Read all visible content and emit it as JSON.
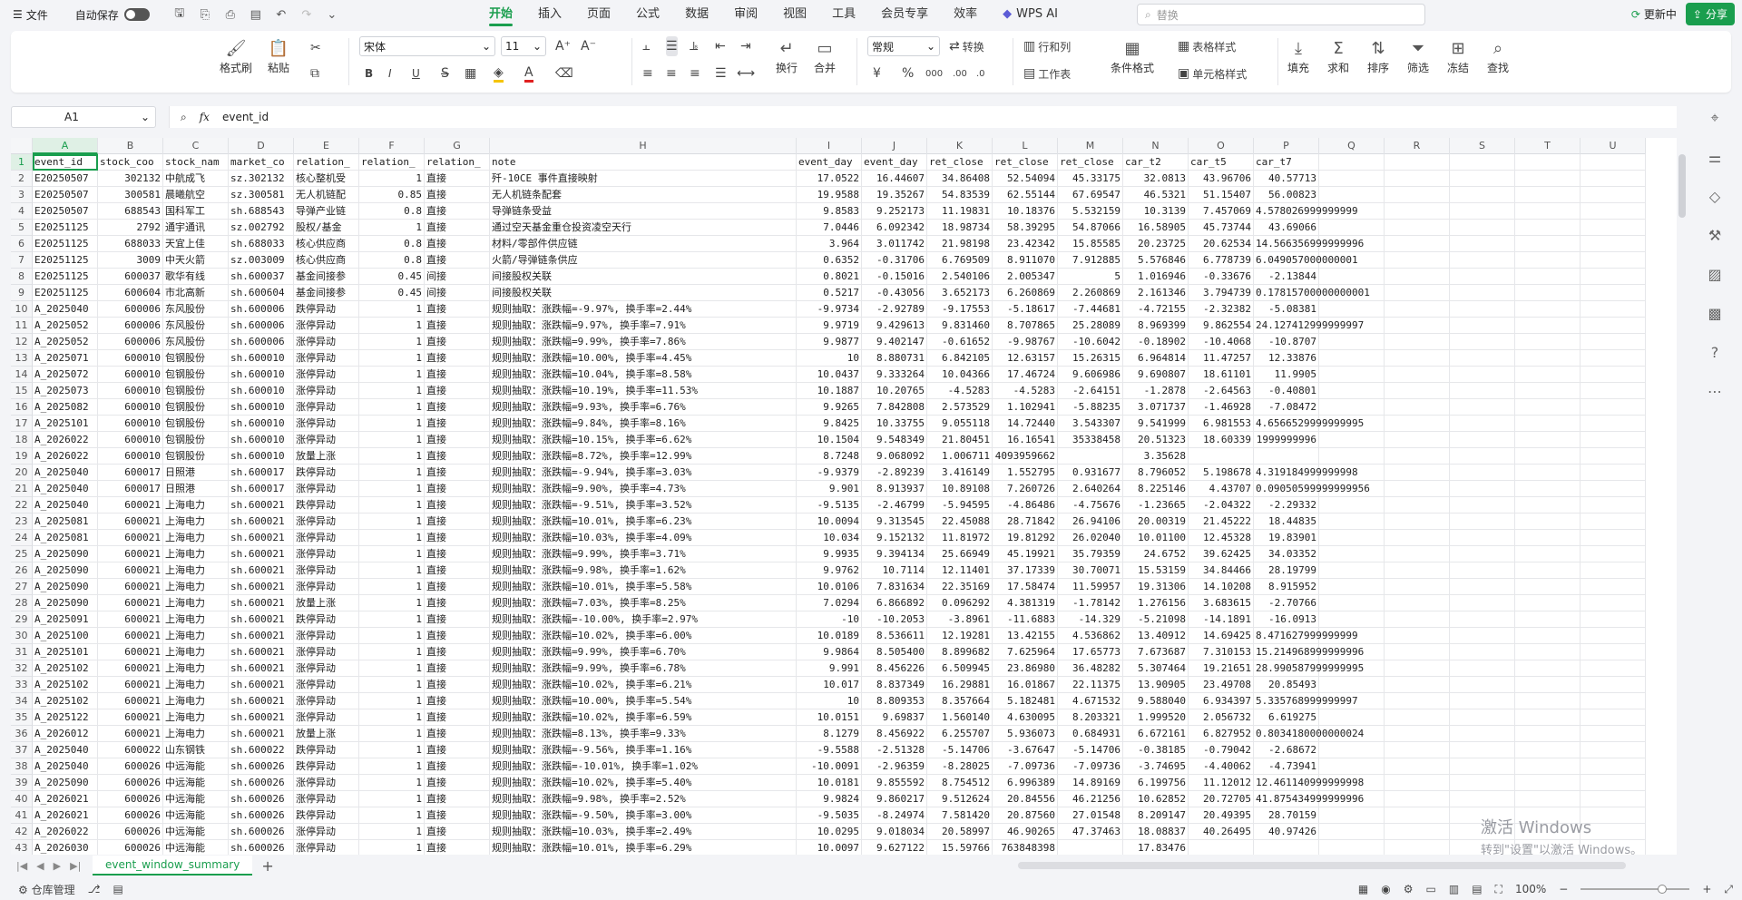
{
  "titlebar": {
    "file_label": "文件",
    "autosave_label": "自动保存",
    "tabs": [
      "开始",
      "插入",
      "页面",
      "公式",
      "数据",
      "审阅",
      "视图",
      "工具",
      "会员专享",
      "效率"
    ],
    "active_tab": "开始",
    "wps_ai_label": "WPS AI",
    "search_placeholder": "替换",
    "update_label": "更新中",
    "share_label": "分享"
  },
  "ribbon": {
    "format_painter": "格式刷",
    "paste": "粘贴",
    "font_name": "宋体",
    "font_size": "11",
    "bold": "B",
    "italic": "I",
    "underline": "U",
    "number_format": "常规",
    "convert": "转换",
    "rows_cols": "行和列",
    "worksheet": "工作表",
    "conditional_format": "条件格式",
    "table_style": "表格样式",
    "cell_style": "单元格样式",
    "fill": "填充",
    "sum": "求和",
    "sort": "排序",
    "filter": "筛选",
    "freeze": "冻结",
    "find": "查找",
    "wrap": "换行",
    "merge": "合并"
  },
  "formula_bar": {
    "cell_ref": "A1",
    "fx": "fx",
    "value": "event_id"
  },
  "grid": {
    "columns": [
      "A",
      "B",
      "C",
      "D",
      "E",
      "F",
      "G",
      "H",
      "I",
      "J",
      "K",
      "L",
      "M",
      "N",
      "O",
      "P",
      "Q",
      "R",
      "S",
      "T",
      "U"
    ],
    "rows": [
      [
        "event_id",
        "stock_coo",
        "stock_nam",
        "market_co",
        "relation_",
        "relation_",
        "relation_",
        "note",
        "event_day",
        "event_day",
        "ret_close",
        "ret_close",
        "ret_close",
        "car_t2",
        "car_t5",
        "car_t7"
      ],
      [
        "E20250507",
        "302132",
        "中航成飞",
        "sz.302132",
        "核心整机受",
        "1",
        "直接",
        "歼-10CE 事件直接映射",
        "17.0522",
        "16.44607",
        "34.86408",
        "52.54094",
        "45.33175",
        "32.0813",
        "43.96706",
        "40.57713"
      ],
      [
        "E20250507",
        "300581",
        "晨曦航空",
        "sz.300581",
        "无人机链配",
        "0.85",
        "直接",
        "无人机链条配套",
        "19.9588",
        "19.35267",
        "54.83539",
        "62.55144",
        "67.69547",
        "46.5321",
        "51.15407",
        "56.00823"
      ],
      [
        "E20250507",
        "688543",
        "国科军工",
        "sh.688543",
        "导弹产业链",
        "0.8",
        "直接",
        "导弹链条受益",
        "9.8583",
        "9.252173",
        "11.19831",
        "10.18376",
        "5.532159",
        "10.3139",
        "7.457069",
        "4.578026999999999"
      ],
      [
        "E20251125",
        "2792",
        "通宇通讯",
        "sz.002792",
        "股权/基金",
        "1",
        "直接",
        "通过空天基金重仓投资凌空天行",
        "7.0446",
        "6.092342",
        "18.98734",
        "58.39295",
        "54.87066",
        "16.58905",
        "45.73744",
        "43.69066"
      ],
      [
        "E20251125",
        "688033",
        "天宜上佳",
        "sh.688033",
        "核心供应商",
        "0.8",
        "直接",
        "材料/零部件供应链",
        "3.964",
        "3.011742",
        "21.98198",
        "23.42342",
        "15.85585",
        "20.23725",
        "20.62534",
        "14.566356999999996"
      ],
      [
        "E20251125",
        "3009",
        "中天火箭",
        "sz.003009",
        "核心供应商",
        "0.8",
        "直接",
        "火箭/导弹链条供应",
        "0.6352",
        "-0.31706",
        "6.769509",
        "8.911070",
        "7.912885",
        "5.576846",
        "6.778739",
        "6.049057000000001"
      ],
      [
        "E20251125",
        "600037",
        "歌华有线",
        "sh.600037",
        "基金间接参",
        "0.45",
        "间接",
        "间接股权关联",
        "0.8021",
        "-0.15016",
        "2.540106",
        "2.005347",
        "5",
        "1.016946",
        "-0.33676",
        "-2.13844"
      ],
      [
        "E20251125",
        "600604",
        "市北高新",
        "sh.600604",
        "基金间接参",
        "0.45",
        "间接",
        "间接股权关联",
        "0.5217",
        "-0.43056",
        "3.652173",
        "6.260869",
        "2.260869",
        "2.161346",
        "3.794739",
        "0.17815700000000001"
      ],
      [
        "A_2025040",
        "600006",
        "东风股份",
        "sh.600006",
        "跌停异动",
        "1",
        "直接",
        "规则抽取：涨跌幅=-9.97%, 换手率=2.44%",
        "-9.9734",
        "-2.92789",
        "-9.17553",
        "-5.18617",
        "-7.44681",
        "-4.72155",
        "-2.32382",
        "-5.08381"
      ],
      [
        "A_2025052",
        "600006",
        "东风股份",
        "sh.600006",
        "涨停异动",
        "1",
        "直接",
        "规则抽取：涨跌幅=9.97%, 换手率=7.91%",
        "9.9719",
        "9.429613",
        "9.831460",
        "8.707865",
        "25.28089",
        "8.969399",
        "9.862554",
        "24.127412999999997"
      ],
      [
        "A_2025052",
        "600006",
        "东风股份",
        "sh.600006",
        "涨停异动",
        "1",
        "直接",
        "规则抽取：涨跌幅=9.99%, 换手率=7.86%",
        "9.9877",
        "9.402147",
        "-0.61652",
        "-9.98767",
        "-10.6042",
        "-0.18902",
        "-10.4068",
        "-10.8707"
      ],
      [
        "A_2025071",
        "600010",
        "包钢股份",
        "sh.600010",
        "涨停异动",
        "1",
        "直接",
        "规则抽取：涨跌幅=10.00%, 换手率=4.45%",
        "10",
        "8.880731",
        "6.842105",
        "12.63157",
        "15.26315",
        "6.964814",
        "11.47257",
        "12.33876"
      ],
      [
        "A_2025072",
        "600010",
        "包钢股份",
        "sh.600010",
        "涨停异动",
        "1",
        "直接",
        "规则抽取：涨跌幅=10.04%, 换手率=8.58%",
        "10.0437",
        "9.333264",
        "10.04366",
        "17.46724",
        "9.606986",
        "9.690807",
        "18.61101",
        "11.9905"
      ],
      [
        "A_2025073",
        "600010",
        "包钢股份",
        "sh.600010",
        "涨停异动",
        "1",
        "直接",
        "规则抽取：涨跌幅=10.19%, 换手率=11.53%",
        "10.1887",
        "10.20765",
        "-4.5283",
        "-4.5283",
        "-2.64151",
        "-1.2878",
        "-2.64563",
        "-0.40801"
      ],
      [
        "A_2025082",
        "600010",
        "包钢股份",
        "sh.600010",
        "涨停异动",
        "1",
        "直接",
        "规则抽取：涨跌幅=9.93%, 换手率=6.76%",
        "9.9265",
        "7.842808",
        "2.573529",
        "1.102941",
        "-5.88235",
        "3.071737",
        "-1.46928",
        "-7.08472"
      ],
      [
        "A_2025101",
        "600010",
        "包钢股份",
        "sh.600010",
        "涨停异动",
        "1",
        "直接",
        "规则抽取：涨跌幅=9.84%, 换手率=8.16%",
        "9.8425",
        "10.33755",
        "9.055118",
        "14.72440",
        "3.543307",
        "9.541999",
        "6.981553",
        "4.6566529999999995"
      ],
      [
        "A_2026022",
        "600010",
        "包钢股份",
        "sh.600010",
        "涨停异动",
        "1",
        "直接",
        "规则抽取：涨跌幅=10.15%, 换手率=6.62%",
        "10.1504",
        "9.548349",
        "21.80451",
        "16.16541",
        "35338458",
        "20.51323",
        "18.60339",
        "1999999996"
      ],
      [
        "A_2026022",
        "600010",
        "包钢股份",
        "sh.600010",
        "放量上涨",
        "1",
        "直接",
        "规则抽取：涨跌幅=8.72%, 换手率=12.99%",
        "8.7248",
        "9.068092",
        "1.006711",
        "4093959662",
        "",
        "3.35628",
        "",
        ""
      ],
      [
        "A_2025040",
        "600017",
        "日照港",
        "sh.600017",
        "跌停异动",
        "1",
        "直接",
        "规则抽取：涨跌幅=-9.94%, 换手率=3.03%",
        "-9.9379",
        "-2.89239",
        "3.416149",
        "1.552795",
        "0.931677",
        "8.796052",
        "5.198678",
        "4.319184999999998"
      ],
      [
        "A_2025040",
        "600017",
        "日照港",
        "sh.600017",
        "涨停异动",
        "1",
        "直接",
        "规则抽取：涨跌幅=9.90%, 换手率=4.73%",
        "9.901",
        "8.913937",
        "10.89108",
        "7.260726",
        "2.640264",
        "8.225146",
        "4.43707",
        "0.09050599999999956"
      ],
      [
        "A_2025040",
        "600021",
        "上海电力",
        "sh.600021",
        "跌停异动",
        "1",
        "直接",
        "规则抽取：涨跌幅=-9.51%, 换手率=3.52%",
        "-9.5135",
        "-2.46799",
        "-5.94595",
        "-4.86486",
        "-4.75676",
        "-1.23665",
        "-2.04322",
        "-2.29332"
      ],
      [
        "A_2025081",
        "600021",
        "上海电力",
        "sh.600021",
        "涨停异动",
        "1",
        "直接",
        "规则抽取：涨跌幅=10.01%, 换手率=6.23%",
        "10.0094",
        "9.313545",
        "22.45088",
        "28.71842",
        "26.94106",
        "20.00319",
        "21.45222",
        "18.44835"
      ],
      [
        "A_2025081",
        "600021",
        "上海电力",
        "sh.600021",
        "涨停异动",
        "1",
        "直接",
        "规则抽取：涨跌幅=10.03%, 换手率=4.09%",
        "10.034",
        "9.152132",
        "11.81972",
        "19.81292",
        "26.02040",
        "10.01100",
        "12.45328",
        "19.83901"
      ],
      [
        "A_2025090",
        "600021",
        "上海电力",
        "sh.600021",
        "涨停异动",
        "1",
        "直接",
        "规则抽取：涨跌幅=9.99%, 换手率=3.71%",
        "9.9935",
        "9.394134",
        "25.66949",
        "45.19921",
        "35.79359",
        "24.6752",
        "39.62425",
        "34.03352"
      ],
      [
        "A_2025090",
        "600021",
        "上海电力",
        "sh.600021",
        "涨停异动",
        "1",
        "直接",
        "规则抽取：涨跌幅=9.98%, 换手率=1.62%",
        "9.9762",
        "10.7114",
        "12.11401",
        "37.17339",
        "30.70071",
        "15.53159",
        "34.84466",
        "28.19799"
      ],
      [
        "A_2025090",
        "600021",
        "上海电力",
        "sh.600021",
        "涨停异动",
        "1",
        "直接",
        "规则抽取：涨跌幅=10.01%, 换手率=5.58%",
        "10.0106",
        "7.831634",
        "22.35169",
        "17.58474",
        "11.59957",
        "19.31306",
        "14.10208",
        "8.915952"
      ],
      [
        "A_2025090",
        "600021",
        "上海电力",
        "sh.600021",
        "放量上涨",
        "1",
        "直接",
        "规则抽取：涨跌幅=7.03%, 换手率=8.25%",
        "7.0294",
        "6.866892",
        "0.096292",
        "4.381319",
        "-1.78142",
        "1.276156",
        "3.683615",
        "-2.70766"
      ],
      [
        "A_2025091",
        "600021",
        "上海电力",
        "sh.600021",
        "跌停异动",
        "1",
        "直接",
        "规则抽取：涨跌幅=-10.00%, 换手率=2.97%",
        "-10",
        "-10.2053",
        "-3.8961",
        "-11.6883",
        "-14.329",
        "-5.21098",
        "-14.1891",
        "-16.0913"
      ],
      [
        "A_2025100",
        "600021",
        "上海电力",
        "sh.600021",
        "涨停异动",
        "1",
        "直接",
        "规则抽取：涨跌幅=10.02%, 换手率=6.00%",
        "10.0189",
        "8.536611",
        "12.19281",
        "13.42155",
        "4.536862",
        "13.40912",
        "14.69425",
        "8.471627999999999"
      ],
      [
        "A_2025101",
        "600021",
        "上海电力",
        "sh.600021",
        "涨停异动",
        "1",
        "直接",
        "规则抽取：涨跌幅=9.99%, 换手率=6.70%",
        "9.9864",
        "8.505400",
        "8.899682",
        "7.625964",
        "17.65773",
        "7.673687",
        "7.310153",
        "15.214968999999996"
      ],
      [
        "A_2025102",
        "600021",
        "上海电力",
        "sh.600021",
        "涨停异动",
        "1",
        "直接",
        "规则抽取：涨跌幅=9.99%, 换手率=6.78%",
        "9.991",
        "8.456226",
        "6.509945",
        "23.86980",
        "36.48282",
        "5.307464",
        "19.21651",
        "28.990587999999995"
      ],
      [
        "A_2025102",
        "600021",
        "上海电力",
        "sh.600021",
        "涨停异动",
        "1",
        "直接",
        "规则抽取：涨跌幅=10.02%, 换手率=6.21%",
        "10.017",
        "8.837349",
        "16.29881",
        "16.01867",
        "22.11375",
        "13.90905",
        "23.49708",
        "20.85493"
      ],
      [
        "A_2025102",
        "600021",
        "上海电力",
        "sh.600021",
        "涨停异动",
        "1",
        "直接",
        "规则抽取：涨跌幅=10.00%, 换手率=5.54%",
        "10",
        "8.809353",
        "8.357664",
        "5.182481",
        "4.671532",
        "9.588040",
        "6.934397",
        "5.335768999999997"
      ],
      [
        "A_2025122",
        "600021",
        "上海电力",
        "sh.600021",
        "涨停异动",
        "1",
        "直接",
        "规则抽取：涨跌幅=10.02%, 换手率=6.59%",
        "10.0151",
        "9.69837",
        "1.560140",
        "4.630095",
        "8.203321",
        "1.999520",
        "2.056732",
        "6.619275"
      ],
      [
        "A_2026012",
        "600021",
        "上海电力",
        "sh.600021",
        "放量上涨",
        "1",
        "直接",
        "规则抽取：涨跌幅=8.13%, 换手率=9.33%",
        "8.1279",
        "8.456922",
        "6.255707",
        "5.936073",
        "0.684931",
        "6.672161",
        "6.827952",
        "0.8034180000000024"
      ],
      [
        "A_2025040",
        "600022",
        "山东钢铁",
        "sh.600022",
        "跌停异动",
        "1",
        "直接",
        "规则抽取：涨跌幅=-9.56%, 换手率=1.16%",
        "-9.5588",
        "-2.51328",
        "-5.14706",
        "-3.67647",
        "-5.14706",
        "-0.38185",
        "-0.79042",
        "-2.68672"
      ],
      [
        "A_2025040",
        "600026",
        "中远海能",
        "sh.600026",
        "跌停异动",
        "1",
        "直接",
        "规则抽取：涨跌幅=-10.01%, 换手率=1.02%",
        "-10.0091",
        "-2.96359",
        "-8.28025",
        "-7.09736",
        "-7.09736",
        "-3.74695",
        "-4.40062",
        "-4.73941"
      ],
      [
        "A_2025090",
        "600026",
        "中远海能",
        "sh.600026",
        "涨停异动",
        "1",
        "直接",
        "规则抽取：涨跌幅=10.02%, 换手率=5.40%",
        "10.0181",
        "9.855592",
        "8.754512",
        "6.996389",
        "14.89169",
        "6.199756",
        "11.12012",
        "12.461140999999998"
      ],
      [
        "A_2026021",
        "600026",
        "中远海能",
        "sh.600026",
        "涨停异动",
        "1",
        "直接",
        "规则抽取：涨跌幅=9.98%, 换手率=2.52%",
        "9.9824",
        "9.860217",
        "9.512624",
        "20.84556",
        "46.21256",
        "10.62852",
        "20.72705",
        "41.875434999999996"
      ],
      [
        "A_2026021",
        "600026",
        "中远海能",
        "sh.600026",
        "跌停异动",
        "1",
        "直接",
        "规则抽取：涨跌幅=-9.50%, 换手率=3.00%",
        "-9.5035",
        "-8.24974",
        "7.581420",
        "20.87560",
        "27.01548",
        "8.209147",
        "20.49395",
        "28.70159"
      ],
      [
        "A_2026022",
        "600026",
        "中远海能",
        "sh.600026",
        "涨停异动",
        "1",
        "直接",
        "规则抽取：涨跌幅=10.03%, 换手率=2.49%",
        "10.0295",
        "9.018034",
        "20.58997",
        "46.90265",
        "47.37463",
        "18.08837",
        "40.26495",
        "40.97426"
      ],
      [
        "A_2026030",
        "600026",
        "中远海能",
        "sh.600026",
        "涨停异动",
        "1",
        "直接",
        "规则抽取：涨跌幅=10.01%, 换手率=6.29%",
        "10.0097",
        "9.627122",
        "15.59766",
        "763848398",
        "",
        "17.83476",
        "",
        ""
      ]
    ]
  },
  "sheet_tab": "event_window_summary",
  "statusbar": {
    "repo_label": "仓库管理",
    "zoom": "100%"
  },
  "watermark": {
    "line1": "激活 Windows",
    "line2": "转到\"设置\"以激活 Windows。"
  }
}
